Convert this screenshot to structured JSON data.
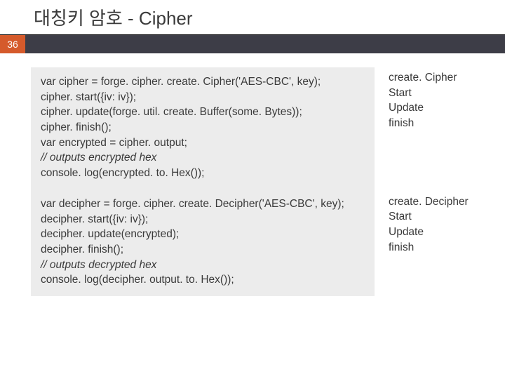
{
  "title": "대칭키 암호 - Cipher",
  "page_number": "36",
  "code": {
    "cipher": {
      "l1": "var cipher = forge. cipher. create. Cipher('AES-CBC', key);",
      "l2": "cipher. start({iv: iv});",
      "l3": "cipher. update(forge. util. create. Buffer(some. Bytes));",
      "l4": "cipher. finish();",
      "l5": "var encrypted = cipher. output;",
      "l6": "// outputs encrypted hex",
      "l7": "console. log(encrypted. to. Hex());"
    },
    "decipher": {
      "l1": "var decipher = forge. cipher. create. Decipher('AES-CBC', key);",
      "l2": "decipher. start({iv: iv});",
      "l3": "decipher. update(encrypted);",
      "l4": "decipher. finish();",
      "l5": "// outputs decrypted hex",
      "l6": "console. log(decipher. output. to. Hex());"
    }
  },
  "notes": {
    "cipher": {
      "a": "create. Cipher",
      "b": "Start",
      "c": "Update",
      "d": "finish"
    },
    "decipher": {
      "a": "create. Decipher",
      "b": "Start",
      "c": "Update",
      "d": "finish"
    }
  }
}
